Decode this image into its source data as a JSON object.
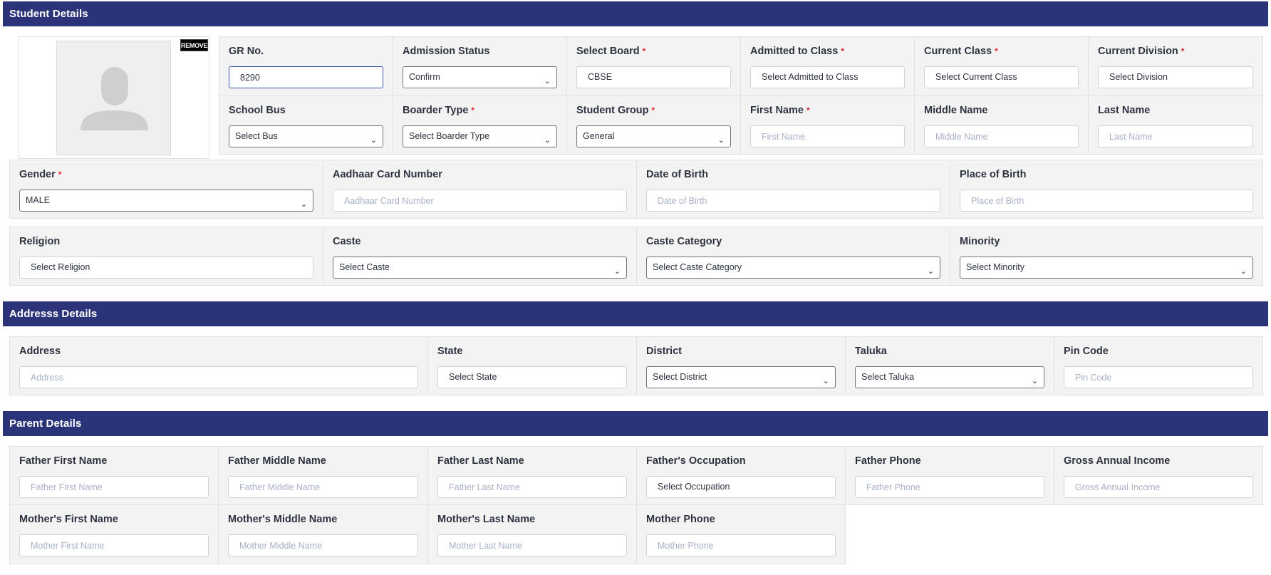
{
  "sections": {
    "student": "Student Details",
    "address": "Addresss Details",
    "parent": "Parent Details"
  },
  "photo": {
    "remove_label": "REMOVE"
  },
  "student": {
    "gr_no": {
      "label": "GR No.",
      "value": "8290"
    },
    "admission_status": {
      "label": "Admission Status",
      "value": "Confirm"
    },
    "select_board": {
      "label": "Select Board",
      "value": "CBSE"
    },
    "admitted_to_class": {
      "label": "Admitted to Class",
      "value": "Select Admitted to Class"
    },
    "current_class": {
      "label": "Current Class",
      "value": "Select Current Class"
    },
    "current_division": {
      "label": "Current Division",
      "value": "Select Division"
    },
    "school_bus": {
      "label": "School Bus",
      "value": "Select Bus"
    },
    "boarder_type": {
      "label": "Boarder Type",
      "value": "Select Boarder Type"
    },
    "student_group": {
      "label": "Student Group",
      "value": "General"
    },
    "first_name": {
      "label": "First Name",
      "placeholder": "First Name"
    },
    "middle_name": {
      "label": "Middle Name",
      "placeholder": "Middle Name"
    },
    "last_name": {
      "label": "Last Name",
      "placeholder": "Last Name"
    },
    "gender": {
      "label": "Gender",
      "value": "MALE"
    },
    "aadhaar": {
      "label": "Aadhaar Card Number",
      "placeholder": "Aadhaar Card Number"
    },
    "dob": {
      "label": "Date of Birth",
      "placeholder": "Date of Birth"
    },
    "pob": {
      "label": "Place of Birth",
      "placeholder": "Place of Birth"
    },
    "religion": {
      "label": "Religion",
      "value": "Select Religion"
    },
    "caste": {
      "label": "Caste",
      "value": "Select Caste"
    },
    "caste_category": {
      "label": "Caste Category",
      "value": "Select Caste Category"
    },
    "minority": {
      "label": "Minority",
      "value": "Select Minority"
    }
  },
  "address": {
    "address": {
      "label": "Address",
      "placeholder": "Address"
    },
    "state": {
      "label": "State",
      "value": "Select State"
    },
    "district": {
      "label": "District",
      "value": "Select District"
    },
    "taluka": {
      "label": "Taluka",
      "value": "Select Taluka"
    },
    "pin_code": {
      "label": "Pin Code",
      "placeholder": "Pin Code"
    }
  },
  "parent": {
    "father_first": {
      "label": "Father First Name",
      "placeholder": "Father First Name"
    },
    "father_middle": {
      "label": "Father Middle Name",
      "placeholder": "Father Middle Name"
    },
    "father_last": {
      "label": "Father Last Name",
      "placeholder": "Father Last Name"
    },
    "father_occupation": {
      "label": "Father's Occupation",
      "value": "Select Occupation"
    },
    "father_phone": {
      "label": "Father Phone",
      "placeholder": "Father Phone"
    },
    "gross_income": {
      "label": "Gross Annual Income",
      "placeholder": "Gross Annual Income"
    },
    "mother_first": {
      "label": "Mother's First Name",
      "placeholder": "Mother First Name"
    },
    "mother_middle": {
      "label": "Mother's Middle Name",
      "placeholder": "Mother Middle Name"
    },
    "mother_last": {
      "label": "Mother's Last Name",
      "placeholder": "Mother Last Name"
    },
    "mother_phone": {
      "label": "Mother Phone",
      "placeholder": "Mother Phone"
    }
  },
  "required_marker": "*",
  "icons": {
    "dropdown": "chevron-down-icon",
    "avatar": "user-avatar-icon"
  }
}
